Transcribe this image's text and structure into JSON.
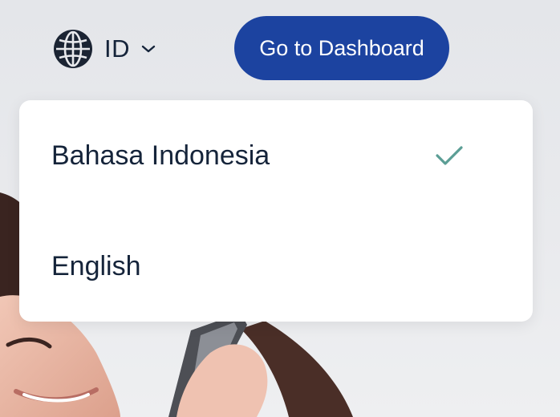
{
  "header": {
    "language_code": "ID",
    "dashboard_button_label": "Go to Dashboard"
  },
  "language_menu": {
    "items": [
      {
        "label": "Bahasa Indonesia",
        "selected": true
      },
      {
        "label": "English",
        "selected": false
      }
    ]
  },
  "colors": {
    "primary_button": "#1c43a0",
    "check_mark": "#5b9e95",
    "text": "#15243a"
  },
  "icons": {
    "language": "globe-icon",
    "dropdown": "chevron-down-icon",
    "selected": "check-icon"
  }
}
